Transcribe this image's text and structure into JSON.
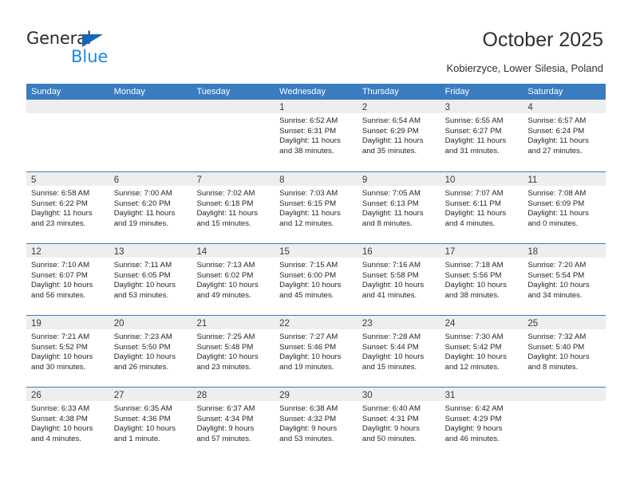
{
  "logo": {
    "word_primary": "General",
    "word_secondary": "Blue",
    "triangle_color": "#1667b5",
    "blue_color": "#1e88d8"
  },
  "header": {
    "title": "October 2025",
    "subtitle": "Kobierzyce, Lower Silesia, Poland"
  },
  "theme": {
    "header_blue": "#3a7cc0",
    "day_band_gray": "#eeeeee",
    "text_color": "#262626"
  },
  "weekdays": [
    "Sunday",
    "Monday",
    "Tuesday",
    "Wednesday",
    "Thursday",
    "Friday",
    "Saturday"
  ],
  "labels": {
    "sunrise_prefix": "Sunrise:",
    "sunset_prefix": "Sunset:",
    "daylight_prefix": "Daylight:"
  },
  "weeks": [
    [
      {
        "empty": true
      },
      {
        "empty": true
      },
      {
        "empty": true
      },
      {
        "day": "1",
        "sunrise": "Sunrise: 6:52 AM",
        "sunset": "Sunset: 6:31 PM",
        "daylight_1": "Daylight: 11 hours",
        "daylight_2": "and 38 minutes."
      },
      {
        "day": "2",
        "sunrise": "Sunrise: 6:54 AM",
        "sunset": "Sunset: 6:29 PM",
        "daylight_1": "Daylight: 11 hours",
        "daylight_2": "and 35 minutes."
      },
      {
        "day": "3",
        "sunrise": "Sunrise: 6:55 AM",
        "sunset": "Sunset: 6:27 PM",
        "daylight_1": "Daylight: 11 hours",
        "daylight_2": "and 31 minutes."
      },
      {
        "day": "4",
        "sunrise": "Sunrise: 6:57 AM",
        "sunset": "Sunset: 6:24 PM",
        "daylight_1": "Daylight: 11 hours",
        "daylight_2": "and 27 minutes."
      }
    ],
    [
      {
        "day": "5",
        "sunrise": "Sunrise: 6:58 AM",
        "sunset": "Sunset: 6:22 PM",
        "daylight_1": "Daylight: 11 hours",
        "daylight_2": "and 23 minutes."
      },
      {
        "day": "6",
        "sunrise": "Sunrise: 7:00 AM",
        "sunset": "Sunset: 6:20 PM",
        "daylight_1": "Daylight: 11 hours",
        "daylight_2": "and 19 minutes."
      },
      {
        "day": "7",
        "sunrise": "Sunrise: 7:02 AM",
        "sunset": "Sunset: 6:18 PM",
        "daylight_1": "Daylight: 11 hours",
        "daylight_2": "and 15 minutes."
      },
      {
        "day": "8",
        "sunrise": "Sunrise: 7:03 AM",
        "sunset": "Sunset: 6:15 PM",
        "daylight_1": "Daylight: 11 hours",
        "daylight_2": "and 12 minutes."
      },
      {
        "day": "9",
        "sunrise": "Sunrise: 7:05 AM",
        "sunset": "Sunset: 6:13 PM",
        "daylight_1": "Daylight: 11 hours",
        "daylight_2": "and 8 minutes."
      },
      {
        "day": "10",
        "sunrise": "Sunrise: 7:07 AM",
        "sunset": "Sunset: 6:11 PM",
        "daylight_1": "Daylight: 11 hours",
        "daylight_2": "and 4 minutes."
      },
      {
        "day": "11",
        "sunrise": "Sunrise: 7:08 AM",
        "sunset": "Sunset: 6:09 PM",
        "daylight_1": "Daylight: 11 hours",
        "daylight_2": "and 0 minutes."
      }
    ],
    [
      {
        "day": "12",
        "sunrise": "Sunrise: 7:10 AM",
        "sunset": "Sunset: 6:07 PM",
        "daylight_1": "Daylight: 10 hours",
        "daylight_2": "and 56 minutes."
      },
      {
        "day": "13",
        "sunrise": "Sunrise: 7:11 AM",
        "sunset": "Sunset: 6:05 PM",
        "daylight_1": "Daylight: 10 hours",
        "daylight_2": "and 53 minutes."
      },
      {
        "day": "14",
        "sunrise": "Sunrise: 7:13 AM",
        "sunset": "Sunset: 6:02 PM",
        "daylight_1": "Daylight: 10 hours",
        "daylight_2": "and 49 minutes."
      },
      {
        "day": "15",
        "sunrise": "Sunrise: 7:15 AM",
        "sunset": "Sunset: 6:00 PM",
        "daylight_1": "Daylight: 10 hours",
        "daylight_2": "and 45 minutes."
      },
      {
        "day": "16",
        "sunrise": "Sunrise: 7:16 AM",
        "sunset": "Sunset: 5:58 PM",
        "daylight_1": "Daylight: 10 hours",
        "daylight_2": "and 41 minutes."
      },
      {
        "day": "17",
        "sunrise": "Sunrise: 7:18 AM",
        "sunset": "Sunset: 5:56 PM",
        "daylight_1": "Daylight: 10 hours",
        "daylight_2": "and 38 minutes."
      },
      {
        "day": "18",
        "sunrise": "Sunrise: 7:20 AM",
        "sunset": "Sunset: 5:54 PM",
        "daylight_1": "Daylight: 10 hours",
        "daylight_2": "and 34 minutes."
      }
    ],
    [
      {
        "day": "19",
        "sunrise": "Sunrise: 7:21 AM",
        "sunset": "Sunset: 5:52 PM",
        "daylight_1": "Daylight: 10 hours",
        "daylight_2": "and 30 minutes."
      },
      {
        "day": "20",
        "sunrise": "Sunrise: 7:23 AM",
        "sunset": "Sunset: 5:50 PM",
        "daylight_1": "Daylight: 10 hours",
        "daylight_2": "and 26 minutes."
      },
      {
        "day": "21",
        "sunrise": "Sunrise: 7:25 AM",
        "sunset": "Sunset: 5:48 PM",
        "daylight_1": "Daylight: 10 hours",
        "daylight_2": "and 23 minutes."
      },
      {
        "day": "22",
        "sunrise": "Sunrise: 7:27 AM",
        "sunset": "Sunset: 5:46 PM",
        "daylight_1": "Daylight: 10 hours",
        "daylight_2": "and 19 minutes."
      },
      {
        "day": "23",
        "sunrise": "Sunrise: 7:28 AM",
        "sunset": "Sunset: 5:44 PM",
        "daylight_1": "Daylight: 10 hours",
        "daylight_2": "and 15 minutes."
      },
      {
        "day": "24",
        "sunrise": "Sunrise: 7:30 AM",
        "sunset": "Sunset: 5:42 PM",
        "daylight_1": "Daylight: 10 hours",
        "daylight_2": "and 12 minutes."
      },
      {
        "day": "25",
        "sunrise": "Sunrise: 7:32 AM",
        "sunset": "Sunset: 5:40 PM",
        "daylight_1": "Daylight: 10 hours",
        "daylight_2": "and 8 minutes."
      }
    ],
    [
      {
        "day": "26",
        "sunrise": "Sunrise: 6:33 AM",
        "sunset": "Sunset: 4:38 PM",
        "daylight_1": "Daylight: 10 hours",
        "daylight_2": "and 4 minutes."
      },
      {
        "day": "27",
        "sunrise": "Sunrise: 6:35 AM",
        "sunset": "Sunset: 4:36 PM",
        "daylight_1": "Daylight: 10 hours",
        "daylight_2": "and 1 minute."
      },
      {
        "day": "28",
        "sunrise": "Sunrise: 6:37 AM",
        "sunset": "Sunset: 4:34 PM",
        "daylight_1": "Daylight: 9 hours",
        "daylight_2": "and 57 minutes."
      },
      {
        "day": "29",
        "sunrise": "Sunrise: 6:38 AM",
        "sunset": "Sunset: 4:32 PM",
        "daylight_1": "Daylight: 9 hours",
        "daylight_2": "and 53 minutes."
      },
      {
        "day": "30",
        "sunrise": "Sunrise: 6:40 AM",
        "sunset": "Sunset: 4:31 PM",
        "daylight_1": "Daylight: 9 hours",
        "daylight_2": "and 50 minutes."
      },
      {
        "day": "31",
        "sunrise": "Sunrise: 6:42 AM",
        "sunset": "Sunset: 4:29 PM",
        "daylight_1": "Daylight: 9 hours",
        "daylight_2": "and 46 minutes."
      },
      {
        "empty": true
      }
    ]
  ]
}
